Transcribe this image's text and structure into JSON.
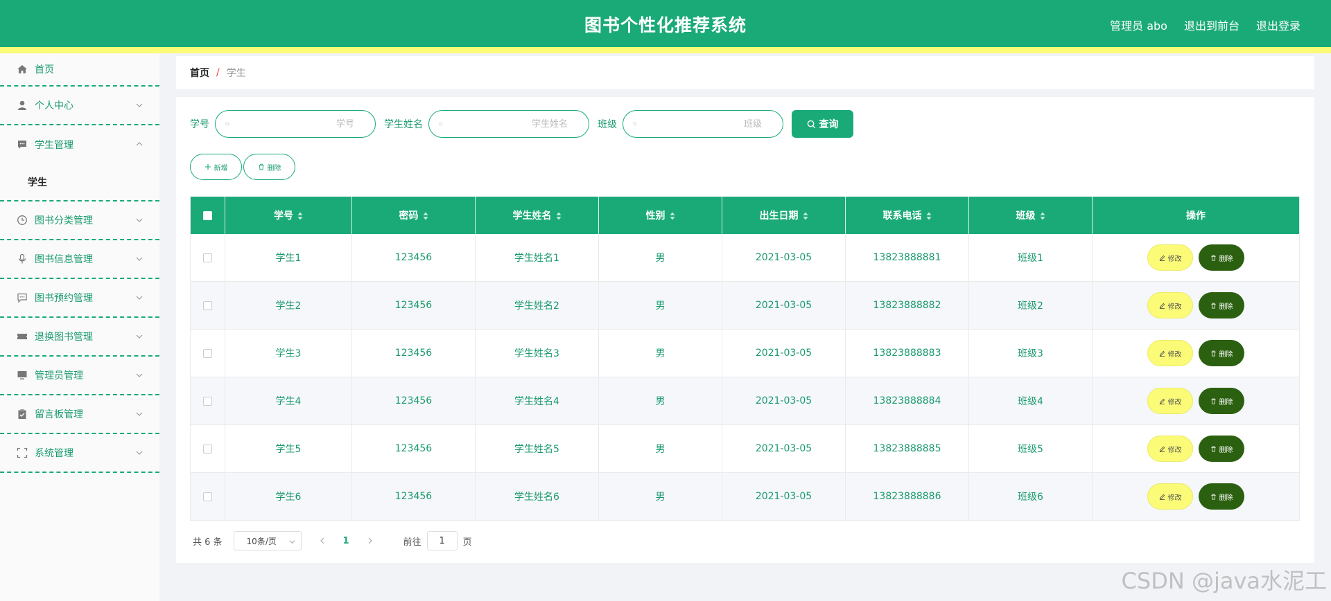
{
  "header": {
    "title": "图书个性化推荐系统",
    "user": "管理员 abo",
    "to_front": "退出到前台",
    "logout": "退出登录"
  },
  "sidebar": {
    "items": [
      {
        "label": "首页",
        "icon": "home-icon"
      },
      {
        "label": "个人中心",
        "icon": "user-icon"
      },
      {
        "label": "学生管理",
        "icon": "chat-icon",
        "expanded": true,
        "sub": [
          "学生"
        ]
      },
      {
        "label": "图书分类管理",
        "icon": "clock-icon"
      },
      {
        "label": "图书信息管理",
        "icon": "microphone-icon"
      },
      {
        "label": "图书预约管理",
        "icon": "message-icon"
      },
      {
        "label": "退换图书管理",
        "icon": "ticket-icon"
      },
      {
        "label": "管理员管理",
        "icon": "monitor-icon"
      },
      {
        "label": "留言板管理",
        "icon": "clipboard-icon"
      },
      {
        "label": "系统管理",
        "icon": "fullscreen-icon"
      }
    ]
  },
  "breadcrumb": {
    "home": "首页",
    "separator": "/",
    "current": "学生"
  },
  "search": {
    "student_no_label": "学号",
    "student_no_placeholder": "学号",
    "name_label": "学生姓名",
    "name_placeholder": "学生姓名",
    "class_label": "班级",
    "class_placeholder": "班级",
    "query_button": "查询"
  },
  "actions": {
    "add": "新增",
    "delete": "删除"
  },
  "table": {
    "columns": [
      "学号",
      "密码",
      "学生姓名",
      "性别",
      "出生日期",
      "联系电话",
      "班级",
      "操作"
    ],
    "rows": [
      [
        "学生1",
        "123456",
        "学生姓名1",
        "男",
        "2021-03-05",
        "13823888881",
        "班级1"
      ],
      [
        "学生2",
        "123456",
        "学生姓名2",
        "男",
        "2021-03-05",
        "13823888882",
        "班级2"
      ],
      [
        "学生3",
        "123456",
        "学生姓名3",
        "男",
        "2021-03-05",
        "13823888883",
        "班级3"
      ],
      [
        "学生4",
        "123456",
        "学生姓名4",
        "男",
        "2021-03-05",
        "13823888884",
        "班级4"
      ],
      [
        "学生5",
        "123456",
        "学生姓名5",
        "男",
        "2021-03-05",
        "13823888885",
        "班级5"
      ],
      [
        "学生6",
        "123456",
        "学生姓名6",
        "男",
        "2021-03-05",
        "13823888886",
        "班级6"
      ]
    ],
    "edit_label": "修改",
    "delete_label": "删除"
  },
  "pagination": {
    "total": "共 6 条",
    "page_size": "10条/页",
    "current_page": "1",
    "goto_prefix": "前往",
    "goto_value": "1",
    "goto_suffix": "页"
  },
  "watermark": "CSDN @java水泥工",
  "colors": {
    "primary": "#1aaa78",
    "accent_yellow": "#fbfb78",
    "delete_dark": "#2b6010"
  }
}
